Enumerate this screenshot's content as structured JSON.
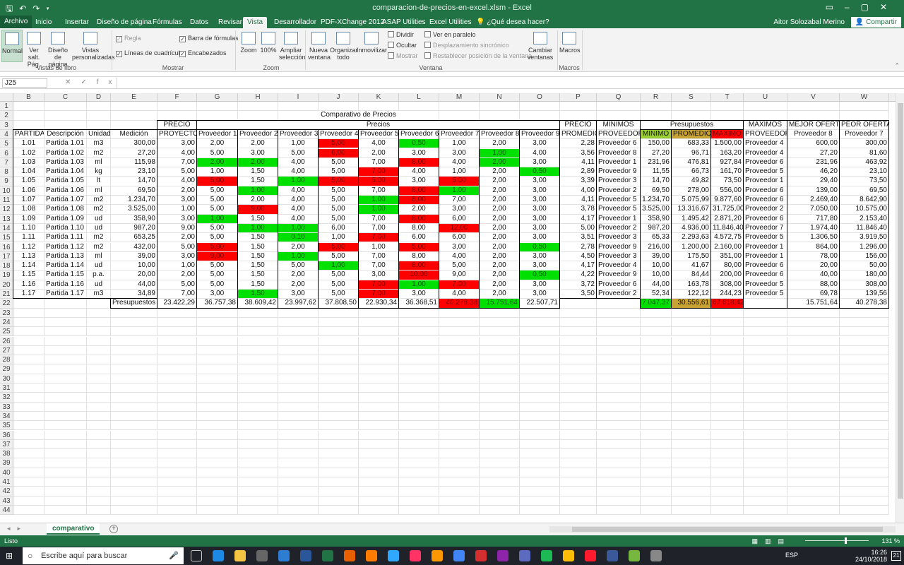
{
  "app": {
    "title": "comparacion-de-precios-en-excel.xlsm - Excel",
    "user": "Aitor Solozabal Merino",
    "share": "Compartir"
  },
  "tabs": [
    "Archivo",
    "Inicio",
    "Insertar",
    "Diseño de página",
    "Fórmulas",
    "Datos",
    "Revisar",
    "Vista",
    "Desarrollador",
    "PDF-XChange 2012",
    "ASAP Utilities",
    "Excel Utilities",
    "¿Qué desea hacer?"
  ],
  "ribbon": {
    "views": [
      "Normal",
      "Ver salt. Pág.",
      "Diseño de página",
      "Vistas personalizadas"
    ],
    "views_group": "Vistas de libro",
    "show": [
      {
        "label": "Regla",
        "checked": true,
        "disabled": true
      },
      {
        "label": "Barra de fórmulas",
        "checked": true
      },
      {
        "label": "Líneas de cuadrícula",
        "checked": true
      },
      {
        "label": "Encabezados",
        "checked": true
      }
    ],
    "show_group": "Mostrar",
    "zoom": [
      "Zoom",
      "100%",
      "Ampliar selección"
    ],
    "zoom_group": "Zoom",
    "window": [
      "Nueva ventana",
      "Organizar todo",
      "Inmovilizar"
    ],
    "window_small": [
      "Dividir",
      "Ocultar",
      "Mostrar"
    ],
    "window_small2": [
      "Ver en paralelo",
      "Desplazamiento sincrónico",
      "Restablecer posición de la ventana"
    ],
    "cambiar": "Cambiar ventanas",
    "window_group": "Ventana",
    "macros": "Macros",
    "macros_group": "Macros"
  },
  "formula_bar": {
    "name_box": "J25",
    "fx": "fx",
    "value": ""
  },
  "columns": [
    "B",
    "C",
    "D",
    "E",
    "F",
    "G",
    "H",
    "I",
    "J",
    "K",
    "L",
    "M",
    "N",
    "O",
    "P",
    "Q",
    "R",
    "S",
    "T",
    "U",
    "V",
    "W"
  ],
  "rows_numbers": [
    "1",
    "2",
    "3",
    "4",
    "5",
    "6",
    "7",
    "8",
    "9",
    "10",
    "11",
    "12",
    "13",
    "14",
    "15",
    "16",
    "17",
    "18",
    "19",
    "20",
    "21",
    "22",
    "23",
    "24",
    "25",
    "26",
    "27",
    "28",
    "29",
    "30",
    "31",
    "32",
    "33",
    "34",
    "35",
    "36",
    "37",
    "38",
    "39",
    "40",
    "41",
    "42",
    "43",
    "44"
  ],
  "sheet": {
    "title": "Comparativo de Precios",
    "header3": {
      "precio": "PRECIO",
      "precios": "Precios",
      "precio2": "PRECIO",
      "minimos": "MINIMOS",
      "presupuestos": "Presupuestos",
      "maximos": "MAXIMOS",
      "mejor": "MEJOR OFERTA",
      "peor": "PEOR OFERTA"
    },
    "header4": [
      "PARTIDA",
      "Descripción",
      "Unidad",
      "Medición",
      "PROYECTO",
      "Proveedor 1",
      "Proveedor 2",
      "Proveedor 3",
      "Proveedor 4",
      "Proveedor 5",
      "Proveedor 6",
      "Proveedor 7",
      "Proveedor 8",
      "Proveedor 9",
      "PROMEDIO",
      "PROVEEDOR",
      "MINIMO",
      "PROMEDIO",
      "MAXIMO",
      "PROVEEDOR",
      "Proveedor 8",
      "Proveedor 7"
    ],
    "rows": [
      [
        "1.01",
        "Partida 1.01",
        "m3",
        "300,00",
        "3,00",
        "2,00",
        "2,00",
        "1,00",
        "5,00",
        "4,00",
        "0,50",
        "1,00",
        "2,00",
        "3,00",
        "2,28",
        "Proveedor 6",
        "150,00",
        "683,33",
        "1.500,00",
        "Proveedor 4",
        "600,00",
        "300,00"
      ],
      [
        "1.02",
        "Partida 1.02",
        "m2",
        "27,20",
        "4,00",
        "5,00",
        "3,00",
        "5,00",
        "6,00",
        "2,00",
        "3,00",
        "3,00",
        "1,00",
        "4,00",
        "3,56",
        "Proveedor 8",
        "27,20",
        "96,71",
        "163,20",
        "Proveedor 4",
        "27,20",
        "81,60"
      ],
      [
        "1.03",
        "Partida 1.03",
        "ml",
        "115,98",
        "7,00",
        "2,00",
        "2,00",
        "4,00",
        "5,00",
        "7,00",
        "8,00",
        "4,00",
        "2,00",
        "3,00",
        "4,11",
        "Proveedor 1",
        "231,96",
        "476,81",
        "927,84",
        "Proveedor 6",
        "231,96",
        "463,92"
      ],
      [
        "1.04",
        "Partida 1.04",
        "kg",
        "23,10",
        "5,00",
        "1,00",
        "1,50",
        "4,00",
        "5,00",
        "7,00",
        "4,00",
        "1,00",
        "2,00",
        "0,50",
        "2,89",
        "Proveedor 9",
        "11,55",
        "66,73",
        "161,70",
        "Proveedor 5",
        "46,20",
        "23,10"
      ],
      [
        "1.05",
        "Partida 1.05",
        "lt",
        "14,70",
        "4,00",
        "5,00",
        "1,50",
        "1,00",
        "5,00",
        "5,00",
        "3,00",
        "5,00",
        "2,00",
        "3,00",
        "3,39",
        "Proveedor 3",
        "14,70",
        "49,82",
        "73,50",
        "Proveedor 1",
        "29,40",
        "73,50"
      ],
      [
        "1.06",
        "Partida 1.06",
        "ml",
        "69,50",
        "2,00",
        "5,00",
        "1,00",
        "4,00",
        "5,00",
        "7,00",
        "8,00",
        "1,00",
        "2,00",
        "3,00",
        "4,00",
        "Proveedor 2",
        "69,50",
        "278,00",
        "556,00",
        "Proveedor 6",
        "139,00",
        "69,50"
      ],
      [
        "1.07",
        "Partida 1.07",
        "m2",
        "1.234,70",
        "3,00",
        "5,00",
        "2,00",
        "4,00",
        "5,00",
        "1,00",
        "8,00",
        "7,00",
        "2,00",
        "3,00",
        "4,11",
        "Proveedor 5",
        "1.234,70",
        "5.075,99",
        "9.877,60",
        "Proveedor 6",
        "2.469,40",
        "8.642,90"
      ],
      [
        "1.08",
        "Partida 1.08",
        "m2",
        "3.525,00",
        "1,00",
        "5,00",
        "9,00",
        "4,00",
        "5,00",
        "1,00",
        "2,00",
        "3,00",
        "2,00",
        "3,00",
        "3,78",
        "Proveedor 5",
        "3.525,00",
        "13.316,67",
        "31.725,00",
        "Proveedor 2",
        "7.050,00",
        "10.575,00"
      ],
      [
        "1.09",
        "Partida 1.09",
        "ud",
        "358,90",
        "3,00",
        "1,00",
        "1,50",
        "4,00",
        "5,00",
        "7,00",
        "8,00",
        "6,00",
        "2,00",
        "3,00",
        "4,17",
        "Proveedor 1",
        "358,90",
        "1.495,42",
        "2.871,20",
        "Proveedor 6",
        "717,80",
        "2.153,40"
      ],
      [
        "1.10",
        "Partida 1.10",
        "ud",
        "987,20",
        "9,00",
        "5,00",
        "1,00",
        "1,00",
        "6,00",
        "7,00",
        "8,00",
        "12,00",
        "2,00",
        "3,00",
        "5,00",
        "Proveedor 2",
        "987,20",
        "4.936,00",
        "11.846,40",
        "Proveedor 7",
        "1.974,40",
        "11.846,40"
      ],
      [
        "1.11",
        "Partida 1.11",
        "m2",
        "653,25",
        "2,00",
        "5,00",
        "1,50",
        "0,10",
        "1,00",
        "7,00",
        "6,00",
        "6,00",
        "2,00",
        "3,00",
        "3,51",
        "Proveedor 3",
        "65,33",
        "2.293,63",
        "4.572,75",
        "Proveedor 5",
        "1.306,50",
        "3.919,50"
      ],
      [
        "1.12",
        "Partida 1.12",
        "m2",
        "432,00",
        "5,00",
        "5,00",
        "1,50",
        "2,00",
        "5,00",
        "1,00",
        "5,00",
        "3,00",
        "2,00",
        "0,50",
        "2,78",
        "Proveedor 9",
        "216,00",
        "1.200,00",
        "2.160,00",
        "Proveedor 1",
        "864,00",
        "1.296,00"
      ],
      [
        "1.13",
        "Partida 1.13",
        "ml",
        "39,00",
        "3,00",
        "9,00",
        "1,50",
        "1,00",
        "5,00",
        "7,00",
        "8,00",
        "4,00",
        "2,00",
        "3,00",
        "4,50",
        "Proveedor 3",
        "39,00",
        "175,50",
        "351,00",
        "Proveedor 1",
        "78,00",
        "156,00"
      ],
      [
        "1.14",
        "Partida 1.14",
        "ud",
        "10,00",
        "1,00",
        "5,00",
        "1,50",
        "5,00",
        "1,00",
        "7,00",
        "8,00",
        "5,00",
        "2,00",
        "3,00",
        "4,17",
        "Proveedor 4",
        "10,00",
        "41,67",
        "80,00",
        "Proveedor 6",
        "20,00",
        "50,00"
      ],
      [
        "1.15",
        "Partida 1.15",
        "p.a.",
        "20,00",
        "2,00",
        "5,00",
        "1,50",
        "2,00",
        "5,00",
        "3,00",
        "10,00",
        "9,00",
        "2,00",
        "0,50",
        "4,22",
        "Proveedor 9",
        "10,00",
        "84,44",
        "200,00",
        "Proveedor 6",
        "40,00",
        "180,00"
      ],
      [
        "1.16",
        "Partida 1.16",
        "ud",
        "44,00",
        "5,00",
        "5,00",
        "1,50",
        "2,00",
        "5,00",
        "7,00",
        "1,00",
        "7,00",
        "2,00",
        "3,00",
        "3,72",
        "Proveedor 6",
        "44,00",
        "163,78",
        "308,00",
        "Proveedor 5",
        "88,00",
        "308,00"
      ],
      [
        "1.17",
        "Partida 1.17",
        "m3",
        "34,89",
        "7,00",
        "3,00",
        "1,50",
        "3,00",
        "5,00",
        "7,00",
        "3,00",
        "4,00",
        "2,00",
        "3,00",
        "3,50",
        "Proveedor 2",
        "52,34",
        "122,12",
        "244,23",
        "Proveedor 5",
        "69,78",
        "139,56"
      ]
    ],
    "highlights": [
      [
        "",
        "",
        "",
        "",
        "",
        "",
        "",
        "",
        "red",
        "",
        "grn",
        "",
        "",
        "",
        "",
        "",
        "",
        "",
        "",
        "",
        "",
        ""
      ],
      [
        "",
        "",
        "",
        "",
        "",
        "",
        "",
        "",
        "red",
        "",
        "",
        "",
        "grn",
        "",
        "",
        "",
        "",
        "",
        "",
        "",
        "",
        ""
      ],
      [
        "",
        "",
        "",
        "",
        "",
        "grn",
        "grn",
        "",
        "",
        "",
        "red",
        "",
        "grn",
        "",
        "",
        "",
        "",
        "",
        "",
        "",
        "",
        ""
      ],
      [
        "",
        "",
        "",
        "",
        "",
        "",
        "",
        "",
        "",
        "red",
        "",
        "",
        "",
        "grn",
        "",
        "",
        "",
        "",
        "",
        "",
        "",
        ""
      ],
      [
        "",
        "",
        "",
        "",
        "",
        "red",
        "",
        "grn",
        "red",
        "red",
        "",
        "red",
        "",
        "",
        "",
        "",
        "",
        "",
        "",
        "",
        "",
        ""
      ],
      [
        "",
        "",
        "",
        "",
        "",
        "",
        "grn",
        "",
        "",
        "",
        "red",
        "grn",
        "",
        "",
        "",
        "",
        "",
        "",
        "",
        "",
        "",
        ""
      ],
      [
        "",
        "",
        "",
        "",
        "",
        "",
        "",
        "",
        "",
        "grn",
        "red",
        "",
        "",
        "",
        "",
        "",
        "",
        "",
        "",
        "",
        "",
        ""
      ],
      [
        "",
        "",
        "",
        "",
        "",
        "",
        "red",
        "",
        "",
        "grn",
        "",
        "",
        "",
        "",
        "",
        "",
        "",
        "",
        "",
        "",
        "",
        ""
      ],
      [
        "",
        "",
        "",
        "",
        "",
        "grn",
        "",
        "",
        "",
        "",
        "red",
        "",
        "",
        "",
        "",
        "",
        "",
        "",
        "",
        "",
        "",
        ""
      ],
      [
        "",
        "",
        "",
        "",
        "",
        "",
        "grn",
        "grn",
        "",
        "",
        "",
        "red",
        "",
        "",
        "",
        "",
        "",
        "",
        "",
        "",
        "",
        ""
      ],
      [
        "",
        "",
        "",
        "",
        "",
        "",
        "",
        "grn",
        "",
        "red",
        "",
        "",
        "",
        "",
        "",
        "",
        "",
        "",
        "",
        "",
        "",
        ""
      ],
      [
        "",
        "",
        "",
        "",
        "",
        "red",
        "",
        "",
        "red",
        "",
        "red",
        "",
        "",
        "grn",
        "",
        "",
        "",
        "",
        "",
        "",
        "",
        ""
      ],
      [
        "",
        "",
        "",
        "",
        "",
        "red",
        "",
        "grn",
        "",
        "",
        "",
        "",
        "",
        "",
        "",
        "",
        "",
        "",
        "",
        "",
        "",
        ""
      ],
      [
        "",
        "",
        "",
        "",
        "",
        "",
        "",
        "",
        "grn",
        "",
        "red",
        "",
        "",
        "",
        "",
        "",
        "",
        "",
        "",
        "",
        "",
        ""
      ],
      [
        "",
        "",
        "",
        "",
        "",
        "",
        "",
        "",
        "",
        "",
        "red",
        "",
        "",
        "grn",
        "",
        "",
        "",
        "",
        "",
        "",
        "",
        ""
      ],
      [
        "",
        "",
        "",
        "",
        "",
        "",
        "",
        "",
        "",
        "red",
        "grn",
        "red",
        "",
        "",
        "",
        "",
        "",
        "",
        "",
        "",
        "",
        ""
      ],
      [
        "",
        "",
        "",
        "",
        "",
        "",
        "grn",
        "",
        "",
        "red",
        "",
        "",
        "",
        "",
        "",
        "",
        "",
        "",
        "",
        "",
        "",
        ""
      ]
    ],
    "totals_label": "Presupuestos",
    "totals": [
      "23.422,29",
      "36.757,38",
      "38.609,42",
      "23.997,62",
      "37.808,50",
      "22.930,34",
      "36.368,51",
      "40.278,38",
      "15.751,64",
      "22.507,71"
    ],
    "totals_summary": {
      "min": "7.047,37",
      "avg": "30.556,61",
      "max": "67.618,42",
      "mejor": "15.751,64",
      "peor": "40.278,38"
    }
  },
  "sheet_tab": "comparativo",
  "status": {
    "ready": "Listo",
    "zoom": "131 %"
  },
  "taskbar": {
    "search": "Escribe aquí para buscar",
    "lang": "ESP",
    "time": "16:26",
    "date": "24/10/2018",
    "notif": "21"
  },
  "colors": {
    "excel_green": "#217346",
    "red": "#ff0000",
    "green": "#00e000"
  }
}
